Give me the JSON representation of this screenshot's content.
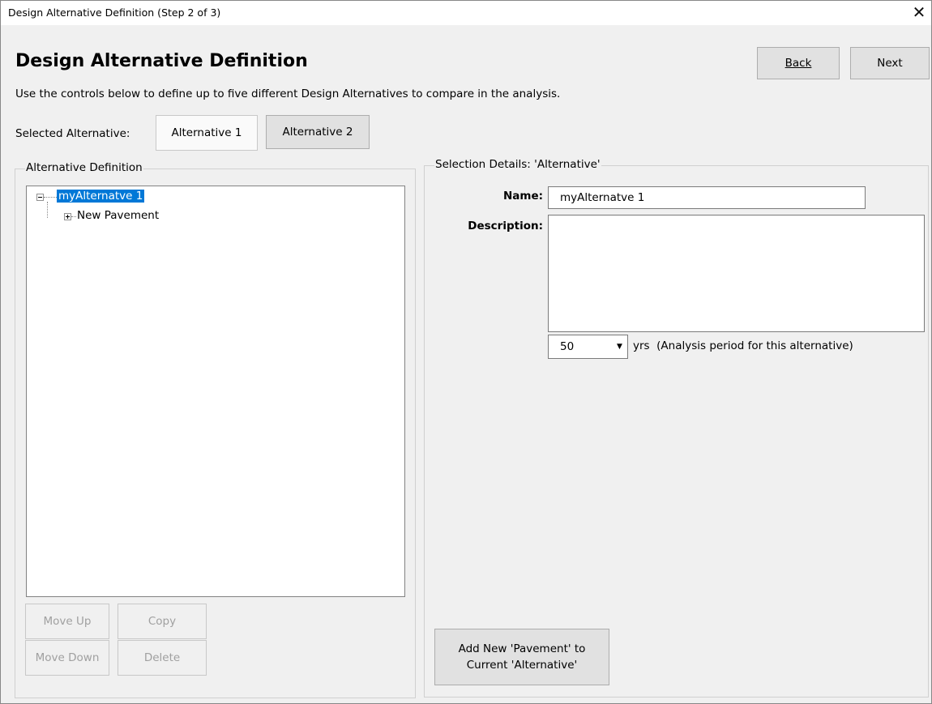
{
  "window": {
    "title": "Design Alternative Definition (Step 2 of 3)"
  },
  "header": {
    "page_title": "Design Alternative Definition",
    "back_label": "Back",
    "next_label": "Next",
    "instructions": "Use the controls below to define up to five different Design Alternatives to compare in the analysis."
  },
  "alternatives": {
    "label": "Selected Alternative:",
    "tabs": [
      {
        "label": "Alternative 1",
        "selected": true
      },
      {
        "label": "Alternative 2",
        "selected": false
      }
    ]
  },
  "alt_definition": {
    "legend": "Alternative Definition",
    "tree": [
      {
        "label": "myAlternatve 1",
        "expanded": true,
        "selected": true
      },
      {
        "label": "New Pavement",
        "expanded": false,
        "selected": false
      }
    ],
    "buttons": {
      "move_up": "Move Up",
      "copy": "Copy",
      "move_down": "Move Down",
      "delete": "Delete"
    }
  },
  "selection_details": {
    "legend": "Selection Details: 'Alternative'",
    "name_label": "Name:",
    "name_value": "myAlternatve 1",
    "description_label": "Description:",
    "description_value": "",
    "period_value": "50",
    "period_text": "yrs  (Analysis period for this alternative)",
    "add_button_line1": "Add New 'Pavement' to",
    "add_button_line2": "Current 'Alternative'"
  },
  "colors": {
    "selection": "#0078d7",
    "window_bg": "#f0f0f0"
  }
}
